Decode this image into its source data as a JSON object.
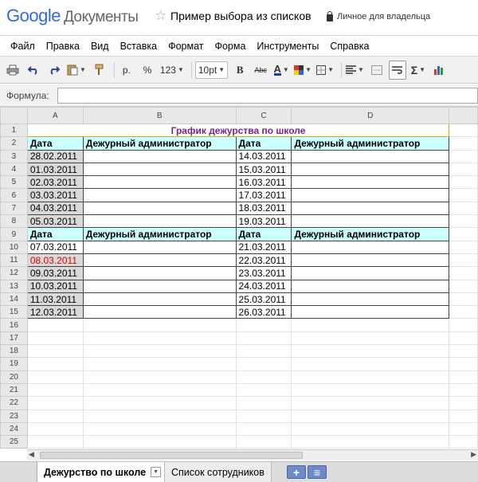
{
  "header": {
    "logo_google": "Google",
    "logo_docs": "Документы",
    "doc_title": "Пример выбора из списков",
    "privacy": "Личное для владельца"
  },
  "menu": [
    "Файл",
    "Правка",
    "Вид",
    "Вставка",
    "Формат",
    "Форма",
    "Инструменты",
    "Справка"
  ],
  "toolbar": {
    "currency": "р.",
    "percent": "%",
    "number_format": "123",
    "font_size": "10pt",
    "bold": "B",
    "strike": "Abc",
    "text_color": "A",
    "sigma": "Σ",
    "icons": [
      "print-icon",
      "undo-icon",
      "redo-icon",
      "paste-icon",
      "paint-format-icon",
      "bg-color-icon",
      "borders-icon",
      "align-icon",
      "merge-icon",
      "wrap-icon",
      "chart-icon"
    ]
  },
  "formula": {
    "label": "Формула:",
    "value": ""
  },
  "columns": [
    "A",
    "B",
    "C",
    "D"
  ],
  "sheet": {
    "title": "График дежурства по школе",
    "head_date": "Дата",
    "head_admin": "Дежурный администратор",
    "block1_left": [
      "28.02.2011",
      "01.03.2011",
      "02.03.2011",
      "03.03.2011",
      "04.03.2011",
      "05.03.2011"
    ],
    "block1_right": [
      "14.03.2011",
      "15.03.2011",
      "16.03.2011",
      "17.03.2011",
      "18.03.2011",
      "19.03.2011"
    ],
    "block2_left": [
      "07.03.2011",
      "08.03.2011",
      "09.03.2011",
      "10.03.2011",
      "11.03.2011",
      "12.03.2011"
    ],
    "block2_right": [
      "21.03.2011",
      "22.03.2011",
      "23.03.2011",
      "24.03.2011",
      "25.03.2011",
      "26.03.2011"
    ],
    "red_date": "08.03.2011",
    "row_numbers": [
      "1",
      "2",
      "3",
      "4",
      "5",
      "6",
      "7",
      "8",
      "9",
      "10",
      "11",
      "12",
      "13",
      "14",
      "15",
      "16",
      "17",
      "18",
      "19",
      "20",
      "21",
      "22",
      "23",
      "24",
      "25"
    ]
  },
  "tabs": [
    {
      "label": "Дежурство по школе",
      "active": true
    },
    {
      "label": "Список сотрудников",
      "active": false
    }
  ],
  "tab_buttons": {
    "add": "+",
    "list": "≡"
  },
  "colors": {
    "header_bg": "#ccffff",
    "date_bg": "#d9d9d9",
    "title_color": "#7f1f7f",
    "holiday": "#dd0000"
  }
}
